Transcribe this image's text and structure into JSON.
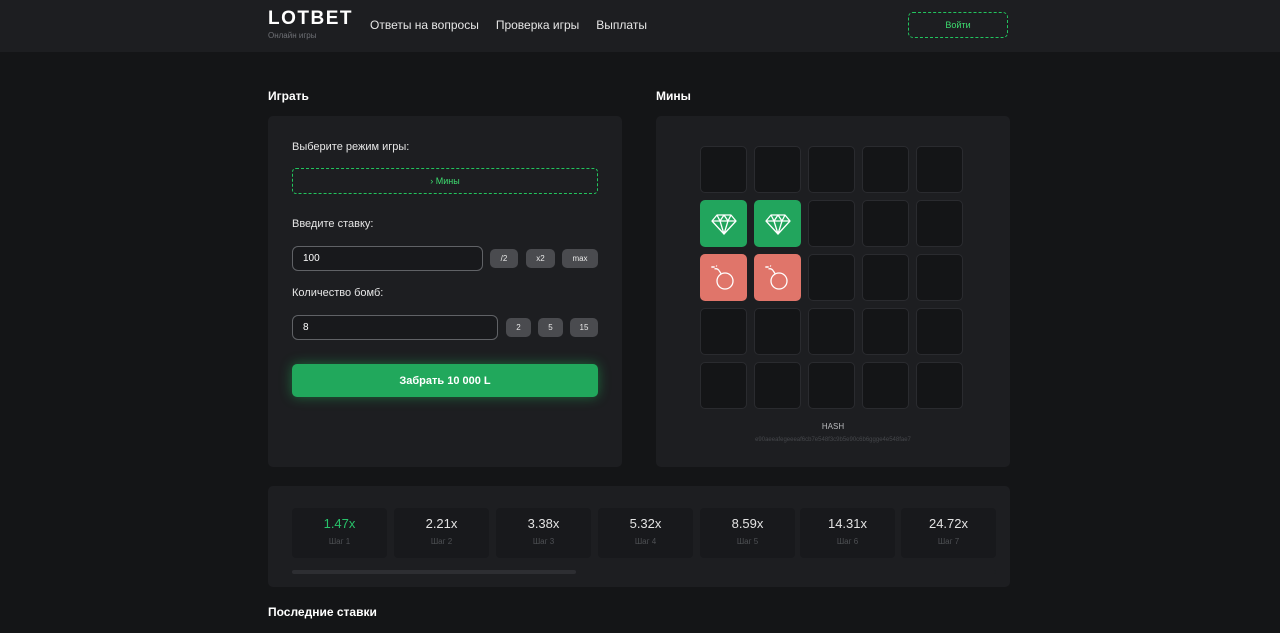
{
  "header": {
    "logo_title": "LOTBET",
    "logo_subtitle": "Онлайн игры",
    "nav": [
      "Ответы на вопросы",
      "Проверка игры",
      "Выплаты"
    ],
    "login_label": "Войти"
  },
  "play": {
    "section_title": "Играть",
    "mode_label": "Выберите режим игры:",
    "mode_value": "› Мины",
    "bet_label": "Введите ставку:",
    "bet_value": "100",
    "bet_chips": [
      "/2",
      "x2",
      "max"
    ],
    "bombs_label": "Количество бомб:",
    "bombs_value": "8",
    "bomb_chips": [
      "2",
      "5",
      "15"
    ],
    "cashout_label": "Забрать 10 000 L"
  },
  "mines": {
    "section_title": "Мины",
    "grid": [
      [
        "closed",
        "closed",
        "closed",
        "closed",
        "closed"
      ],
      [
        "gem",
        "gem",
        "closed",
        "closed",
        "closed"
      ],
      [
        "bomb",
        "bomb",
        "closed",
        "closed",
        "closed"
      ],
      [
        "closed",
        "closed",
        "closed",
        "closed",
        "closed"
      ],
      [
        "closed",
        "closed",
        "closed",
        "closed",
        "closed"
      ]
    ],
    "gem_icon": "diamond-icon",
    "bomb_icon": "bomb-icon",
    "hash_label": "HASH",
    "hash_value": "e90aeeafegeeeaf6cb7e548f3c9b5e90c6b6ggge4e548fae7"
  },
  "steps": {
    "items": [
      {
        "coef": "1.47x",
        "name": "Шаг 1",
        "active": true
      },
      {
        "coef": "2.21x",
        "name": "Шаг 2",
        "active": false
      },
      {
        "coef": "3.38x",
        "name": "Шаг 3",
        "active": false
      },
      {
        "coef": "5.32x",
        "name": "Шаг 4",
        "active": false
      },
      {
        "coef": "8.59x",
        "name": "Шаг 5",
        "active": false
      },
      {
        "coef": "14.31x",
        "name": "Шаг 6",
        "active": false
      },
      {
        "coef": "24.72x",
        "name": "Шаг 7",
        "active": false
      }
    ]
  },
  "recent": {
    "section_title": "Последние ставки"
  },
  "colors": {
    "accent": "#22c55e",
    "gem_tile": "#22a55d",
    "bomb_tile": "#e0756a",
    "background": "#141517",
    "panel": "#1d1e21"
  }
}
